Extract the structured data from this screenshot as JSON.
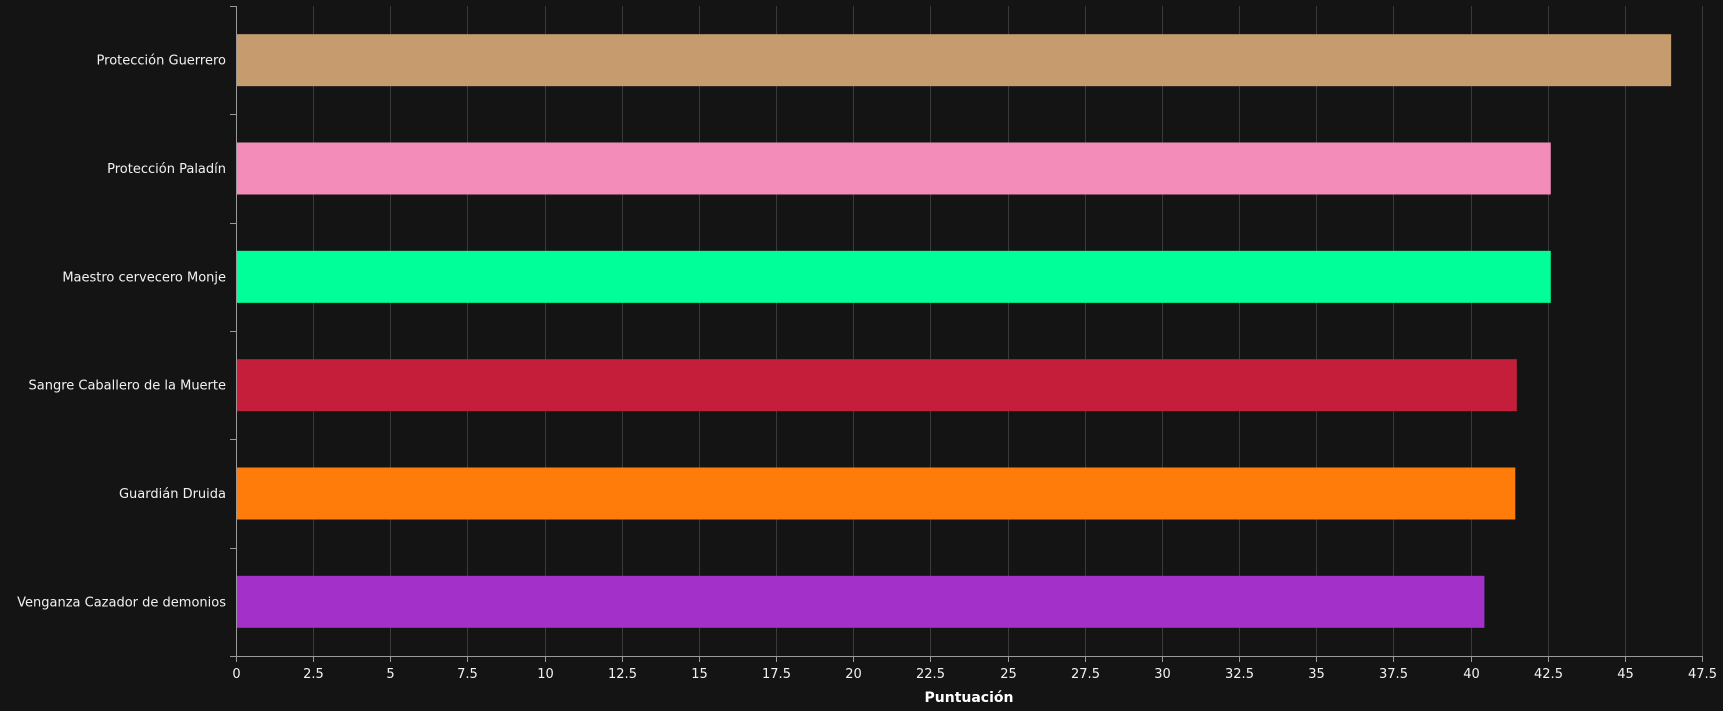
{
  "chart_data": {
    "type": "bar",
    "orientation": "horizontal",
    "categories": [
      "Protección Guerrero",
      "Protección Paladín",
      "Maestro cervecero Monje",
      "Sangre Caballero de la Muerte",
      "Guardián Druida",
      "Venganza Cazador de demonios"
    ],
    "values": [
      46.5,
      42.6,
      42.6,
      41.5,
      41.45,
      40.45
    ],
    "colors": [
      "#C69B6D",
      "#F48CBA",
      "#00FF98",
      "#C41E3A",
      "#FF7C0A",
      "#A330C9"
    ],
    "xlabel": "Puntuación",
    "ylabel": "",
    "title": "",
    "xlim": [
      0,
      47.5
    ],
    "xticks": [
      0,
      2.5,
      5,
      7.5,
      10,
      12.5,
      15,
      17.5,
      20,
      22.5,
      25,
      27.5,
      30,
      32.5,
      35,
      37.5,
      40,
      42.5,
      45,
      47.5
    ],
    "xtick_labels": [
      "0",
      "2.5",
      "5",
      "7.5",
      "10",
      "12.5",
      "15",
      "17.5",
      "20",
      "22.5",
      "25",
      "27.5",
      "30",
      "32.5",
      "35",
      "37.5",
      "40",
      "42.5",
      "45",
      "47.5"
    ],
    "grid": true,
    "legend": "none"
  },
  "theme": {
    "background": "#151415"
  }
}
